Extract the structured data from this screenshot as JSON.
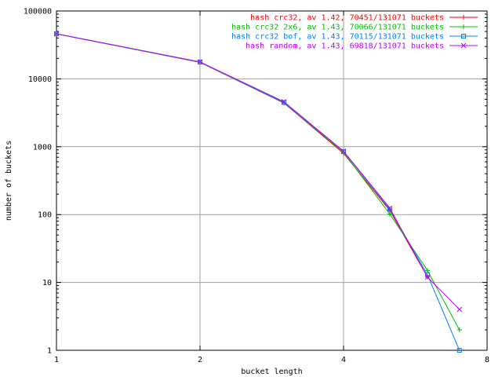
{
  "chart_data": {
    "type": "line",
    "title": "",
    "xlabel": "bucket length",
    "ylabel": "number of buckets",
    "xscale": "log2",
    "yscale": "log10",
    "xlim": [
      1,
      8
    ],
    "ylim": [
      1,
      100000
    ],
    "grid": true,
    "legend_position": "top-right",
    "x_ticks": [
      1,
      2,
      4,
      8
    ],
    "x_tick_labels": [
      "1",
      "2",
      "4",
      "8"
    ],
    "y_ticks": [
      1,
      10,
      100,
      1000,
      10000,
      100000
    ],
    "y_tick_labels": [
      "1",
      "10",
      "100",
      "1000",
      "10000",
      "100000"
    ],
    "series": [
      {
        "name": "hash crc32, av 1.42, 70451/131071 buckets",
        "color": "#ff0000",
        "marker": "plus",
        "x": [
          1,
          2,
          3,
          4,
          5,
          6
        ],
        "y": [
          46000,
          17500,
          4400,
          800,
          115,
          12
        ]
      },
      {
        "name": "hash crc32 2x6, av 1.43, 70066/131071 buckets",
        "color": "#00c000",
        "marker": "cross",
        "x": [
          1,
          2,
          3,
          4,
          5,
          6,
          7
        ],
        "y": [
          46000,
          17600,
          4450,
          830,
          102,
          15,
          2
        ]
      },
      {
        "name": "hash crc32 bof, av 1.43, 70115/131071 buckets",
        "color": "#0080ff",
        "marker": "square",
        "x": [
          1,
          2,
          3,
          4,
          5,
          6,
          7
        ],
        "y": [
          46000,
          17700,
          4500,
          850,
          120,
          13,
          1
        ]
      },
      {
        "name": "hash random, av 1.43, 69818/131071 buckets",
        "color": "#c000ff",
        "marker": "x",
        "x": [
          1,
          2,
          3,
          4,
          5,
          6,
          7
        ],
        "y": [
          46200,
          17800,
          4600,
          860,
          125,
          12,
          4
        ]
      }
    ]
  }
}
